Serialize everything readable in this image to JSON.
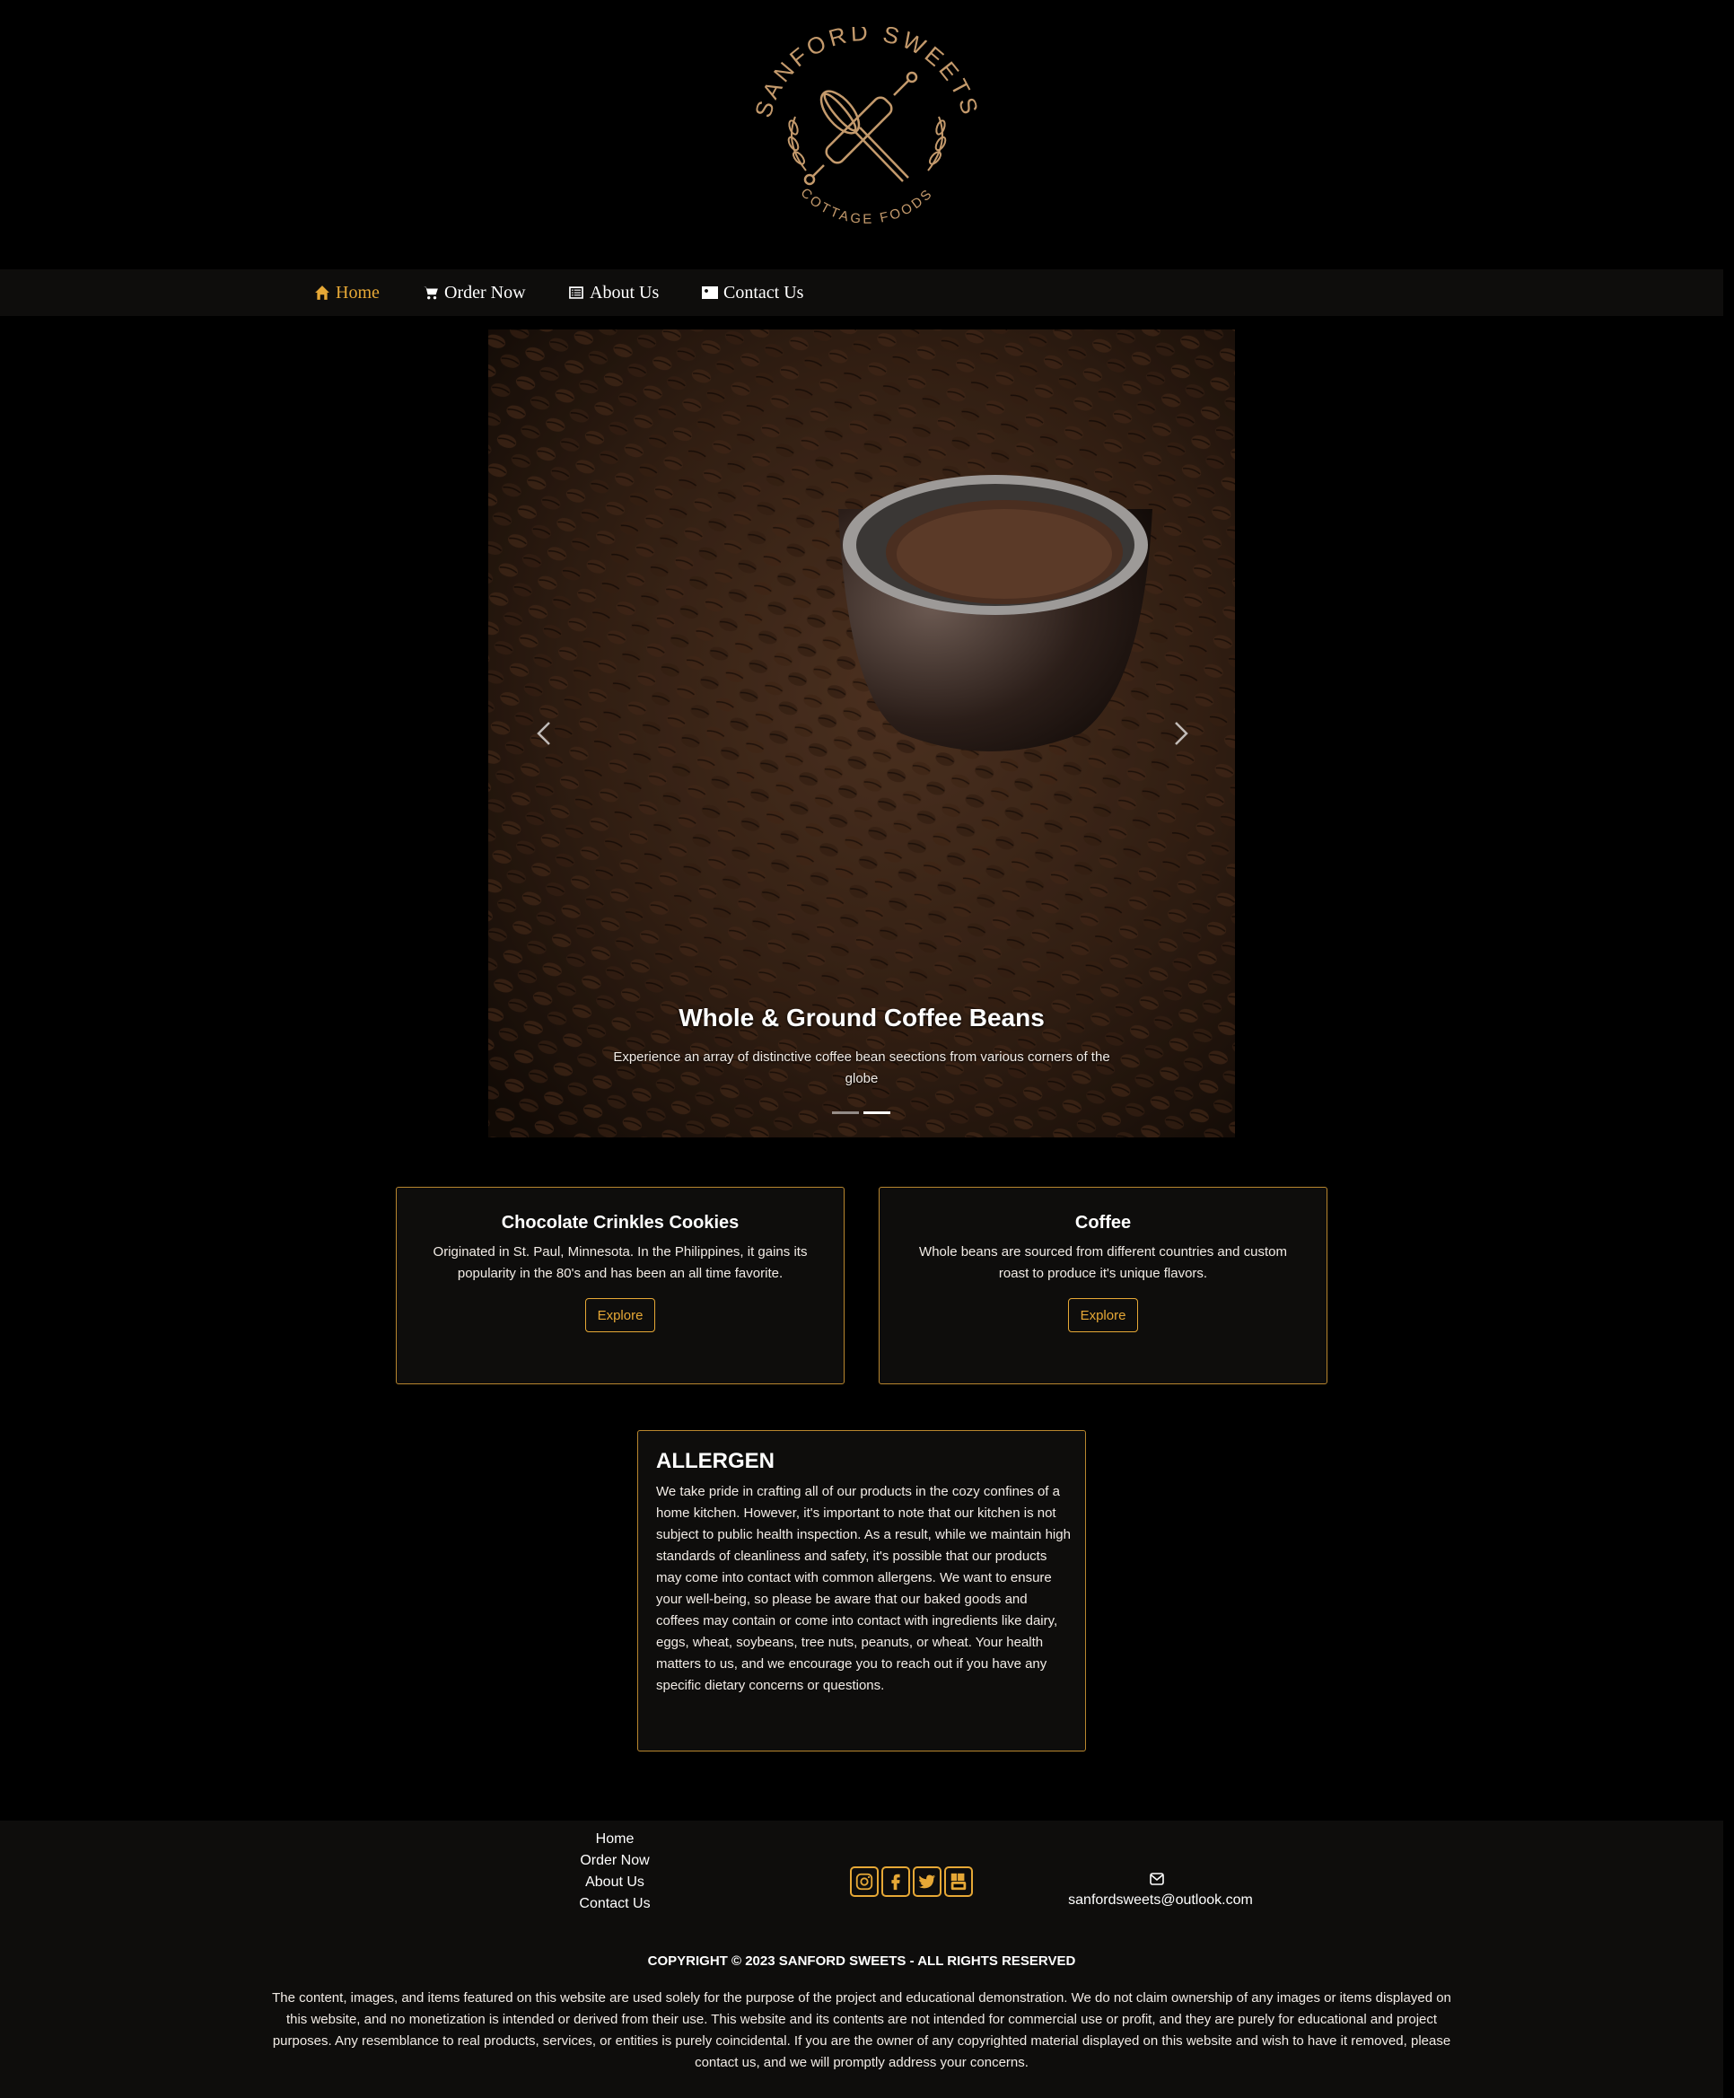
{
  "brand": {
    "logo_text_top": "SANFORD SWEETS",
    "logo_text_bottom": "COTTAGE FOODS",
    "accent_color": "#e6a836",
    "border_color": "#b8862e"
  },
  "nav": {
    "items": [
      {
        "label": "Home",
        "icon": "home-icon",
        "active": true
      },
      {
        "label": "Order Now",
        "icon": "cart-icon",
        "active": false
      },
      {
        "label": "About Us",
        "icon": "list-icon",
        "active": false
      },
      {
        "label": "Contact Us",
        "icon": "contact-card-icon",
        "active": false
      }
    ]
  },
  "hero": {
    "title": "Whole & Ground Coffee Beans",
    "text": "Experience an array of distinctive coffee bean seections from various corners of the globe",
    "slide_count": 2,
    "active_slide": 2
  },
  "cards": [
    {
      "title": "Chocolate Crinkles Cookies",
      "text": "Originated in St. Paul, Minnesota. In the Philippines, it gains its popularity in the 80's and has been an all time favorite.",
      "button": "Explore"
    },
    {
      "title": "Coffee",
      "text": "Whole beans are sourced from different countries and custom roast to produce it's unique flavors.",
      "button": "Explore"
    }
  ],
  "allergen": {
    "title": "ALLERGEN",
    "text": "We take pride in crafting all of our products in the cozy confines of a home kitchen. However, it's important to note that our kitchen is not subject to public health inspection. As a result, while we maintain high standards of cleanliness and safety, it's possible that our products may come into contact with common allergens. We want to ensure your well-being, so please be aware that our baked goods and coffees may contain or come into contact with ingredients like dairy, eggs, wheat, soybeans, tree nuts, peanuts, or wheat. Your health matters to us, and we encourage you to reach out if you have any specific dietary concerns or questions."
  },
  "footer": {
    "links": [
      "Home",
      "Order Now",
      "About Us",
      "Contact Us"
    ],
    "social": [
      "instagram-icon",
      "facebook-icon",
      "twitter-icon",
      "youtube-icon"
    ],
    "email": "sanfordsweets@outlook.com",
    "copyright": "COPYRIGHT © 2023 SANFORD SWEETS - ALL RIGHTS RESERVED",
    "disclaimer": "The content, images, and items featured on this website are used solely for the purpose of the project and educational demonstration. We do not claim ownership of any images or items displayed on this website, and no monetization is intended or derived from their use. This website and its contents are not intended for commercial use or profit, and they are purely for educational and project purposes. Any resemblance to real products, services, or entities is purely coincidental. If you are the owner of any copyrighted material displayed on this website and wish to have it removed, please contact us, and we will promptly address your concerns."
  }
}
